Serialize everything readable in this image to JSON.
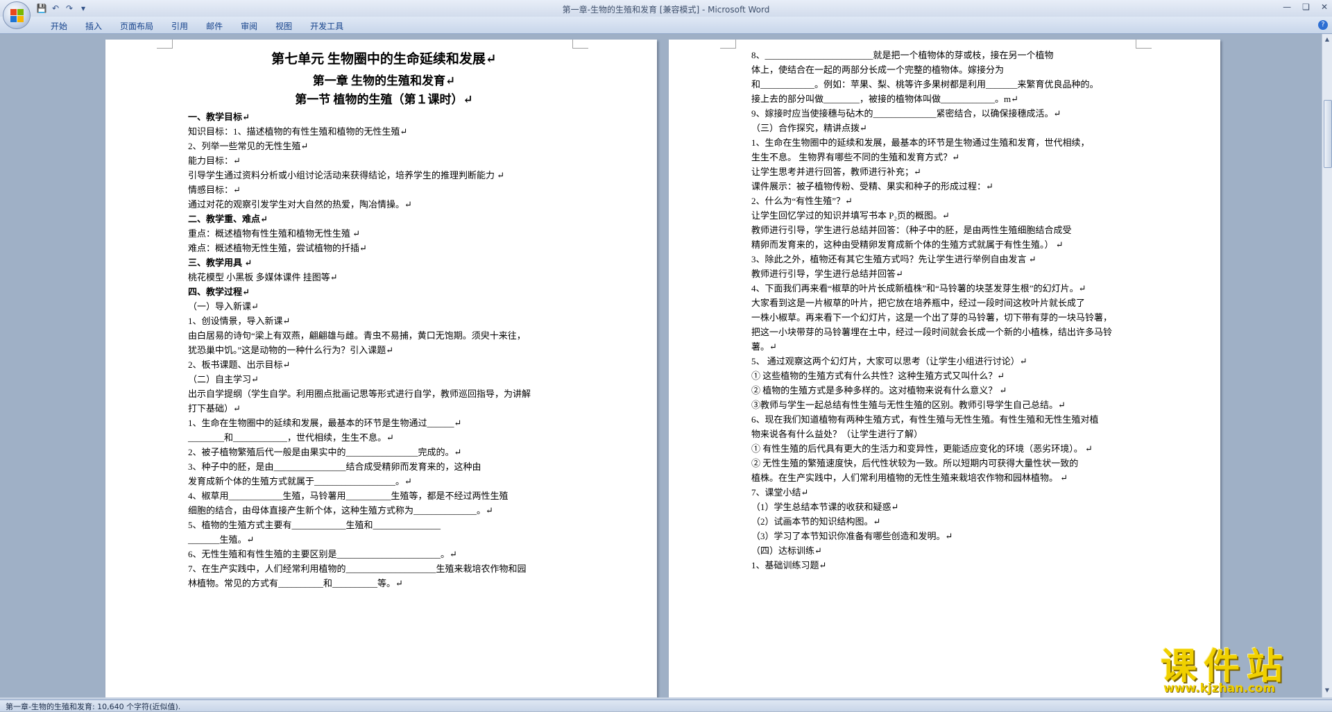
{
  "window": {
    "title": "第一章-生物的生殖和发育 [兼容模式] - Microsoft Word"
  },
  "ribbon": {
    "tabs": [
      "开始",
      "插入",
      "页面布局",
      "引用",
      "邮件",
      "审阅",
      "视图",
      "开发工具"
    ]
  },
  "page1": {
    "lines": [
      "第七单元  生物圈中的生命延续和发展↵",
      "第一章  生物的生殖和发育↵",
      "第一节  植物的生殖（第１课时）↵",
      "一、教学目标↵",
      "知识目标：1、描述植物的有性生殖和植物的无性生殖↵",
      "                2、列举一些常见的无性生殖↵",
      "能力目标：↵",
      "       引导学生通过资料分析或小组讨论活动来获得结论，培养学生的推理判断能力        ↵",
      "情感目标：↵",
      "    通过对花的观察引发学生对大自然的热爱，陶冶情操。↵",
      "二、教学重、难点↵",
      "      重点：概述植物有性生殖和植物无性生殖      ↵",
      "      难点：概述植物无性生殖，尝试植物的扦插↵",
      "三、教学用具    ↵",
      "      桃花模型     小黑板     多媒体课件      挂图等↵",
      "四、教学过程↵",
      "（一）导入新课↵",
      "       1、创设情景，导入新课↵",
      "       由白居易的诗句“梁上有双燕，翩翩雄与雌。青虫不易捕，黄口无饱期。须臾十来往，",
      "犹恐巢中饥。”这是动物的一种什么行为？引入课题↵",
      "       2、板书课题、出示目标↵",
      "（二）自主学习↵",
      "      出示自学提纲（学生自学。利用圈点批画记思等形式进行自学，教师巡回指导，为讲解",
      "打下基础）↵",
      "       1、生命在生物圈中的延续和发展，最基本的环节是生物通过______↵",
      "________和____________，世代相续，生生不息。↵",
      "       2、被子植物繁殖后代一般是由果实中的________________完成的。↵",
      "       3、种子中的胚，是由________________结合成受精卵而发育来的，这种由",
      "发育成新个体的生殖方式就属于__________________。↵",
      "      4、椒草用____________生殖，马铃薯用__________生殖等，都是不经过两性生殖",
      "细胞的结合，由母体直接产生新个体，这种生殖方式称为______________。↵",
      "       5、植物的生殖方式主要有____________生殖和_______________",
      "_______生殖。↵",
      "      6、无性生殖和有性生殖的主要区别是_______________________。↵",
      "       7、在生产实践中，人们经常利用植物的____________________生殖来栽培农作物和园",
      "林植物。常见的方式有__________和__________等。↵"
    ]
  },
  "page2": {
    "lines": [
      "      8、________________________就是把一个植物体的芽或枝，接在另一个植物",
      "体上，使结合在一起的两部分长成一个完整的植物体。嫁接分为",
      "和____________。例如：苹果、梨、桃等许多果树都是利用_______来繁育优良品种的。",
      "接上去的部分叫做________，被接的植物体叫做____________。m↵",
      "      9、嫁接时应当使接穗与砧木的______________紧密结合，以确保接穗成活。↵",
      "（三）合作探究，精讲点拨↵",
      "      1、生命在生物圈中的延续和发展，最基本的环节是生物通过生殖和发育，世代相续，",
      "生生不息。 生物界有哪些不同的生殖和发育方式？↵",
      "       让学生思考并进行回答，教师进行补充；↵",
      "课件展示：被子植物传粉、受精、果实和种子的形成过程：↵",
      "      2、什么为“有性生殖”？↵",
      "          让学生回忆学过的知识并填写书本 P₂页的概图。↵",
      "          教师进行引导，学生进行总结并回答：（种子中的胚，是由两性生殖细胞结合成受",
      "精卵而发育来的，这种由受精卵发育成新个体的生殖方式就属于有性生殖。）         ↵",
      "      3、除此之外，植物还有其它生殖方式吗？先让学生进行举例自由发言   ↵",
      "       教师进行引导，学生进行总结并回答↵",
      "      4、下面我们再来看“椒草的叶片长成新植株”和“马铃薯的块茎发芽生根”的幻灯片。↵",
      "          大家看到这是一片椒草的叶片，把它放在培养瓶中，经过一段时间这枚叶片就长成了",
      "一株小椒草。再来看下一个幻灯片，这是一个出了芽的马铃薯，切下带有芽的一块马铃薯，",
      "把这一小块带芽的马铃薯埋在土中，经过一段时间就会长成一个新的小植株，结出许多马铃",
      "薯。↵",
      "      5、 通过观察这两个幻灯片，大家可以思考（让学生小组进行讨论）↵",
      "      ① 这些植物的生殖方式有什么共性？这种生殖方式又叫什么？↵",
      "      ② 植物的生殖方式是多种多样的。这对植物来说有什么意义？ ↵",
      "      ③教师与学生一起总结有性生殖与无性生殖的区别。教师引导学生自己总结。↵",
      "      6、现在我们知道植物有两种生殖方式，有性生殖与无性生殖。有性生殖和无性生殖对植",
      "物来说各有什么益处？（让学生进行了解）",
      "          ① 有性生殖的后代具有更大的生活力和变异性，更能适应变化的环境（恶劣环境）。  ↵",
      "          ② 无性生殖的繁殖速度快，后代性状较为一致。所以短期内可获得大量性状一致的",
      "植株。在生产实践中，人们常利用植物的无性生殖来栽培农作物和园林植物。          ↵",
      "      7、课堂小结↵",
      "     （1）学生总结本节课的收获和疑惑↵",
      "     （2）试画本节的知识结构图。↵",
      "     （3）学习了本节知识你准备有哪些创造和发明。↵",
      "（四）达标训练↵",
      "      1、基础训练习题↵"
    ]
  },
  "status": {
    "text": "第一章-生物的生殖和发育: 10,640 个字符(近似值)."
  },
  "watermark": {
    "main": "课件站",
    "url": "www.kjzhan.com"
  }
}
